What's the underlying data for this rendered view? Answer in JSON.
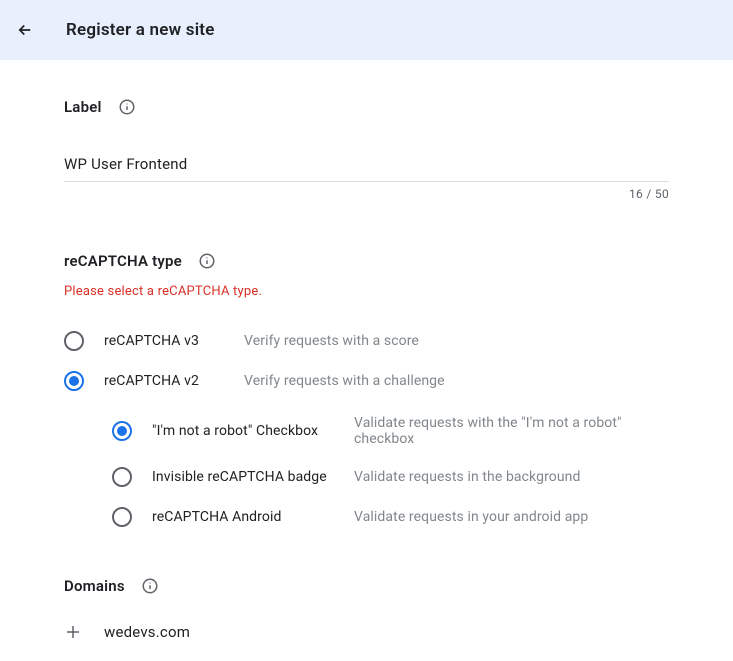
{
  "header": {
    "title": "Register a new site"
  },
  "label": {
    "heading": "Label",
    "value": "WP User Frontend",
    "count": "16 / 50"
  },
  "type": {
    "heading": "reCAPTCHA type",
    "error": "Please select a reCAPTCHA type.",
    "options": [
      {
        "label": "reCAPTCHA v3",
        "desc": "Verify requests with a score",
        "selected": false
      },
      {
        "label": "reCAPTCHA v2",
        "desc": "Verify requests with a challenge",
        "selected": true
      }
    ],
    "subOptions": [
      {
        "label": "\"I'm not a robot\" Checkbox",
        "desc": "Validate requests with the \"I'm not a robot\" checkbox",
        "selected": true
      },
      {
        "label": "Invisible reCAPTCHA badge",
        "desc": "Validate requests in the background",
        "selected": false
      },
      {
        "label": "reCAPTCHA Android",
        "desc": "Validate requests in your android app",
        "selected": false
      }
    ]
  },
  "domains": {
    "heading": "Domains",
    "items": [
      "wedevs.com"
    ]
  }
}
